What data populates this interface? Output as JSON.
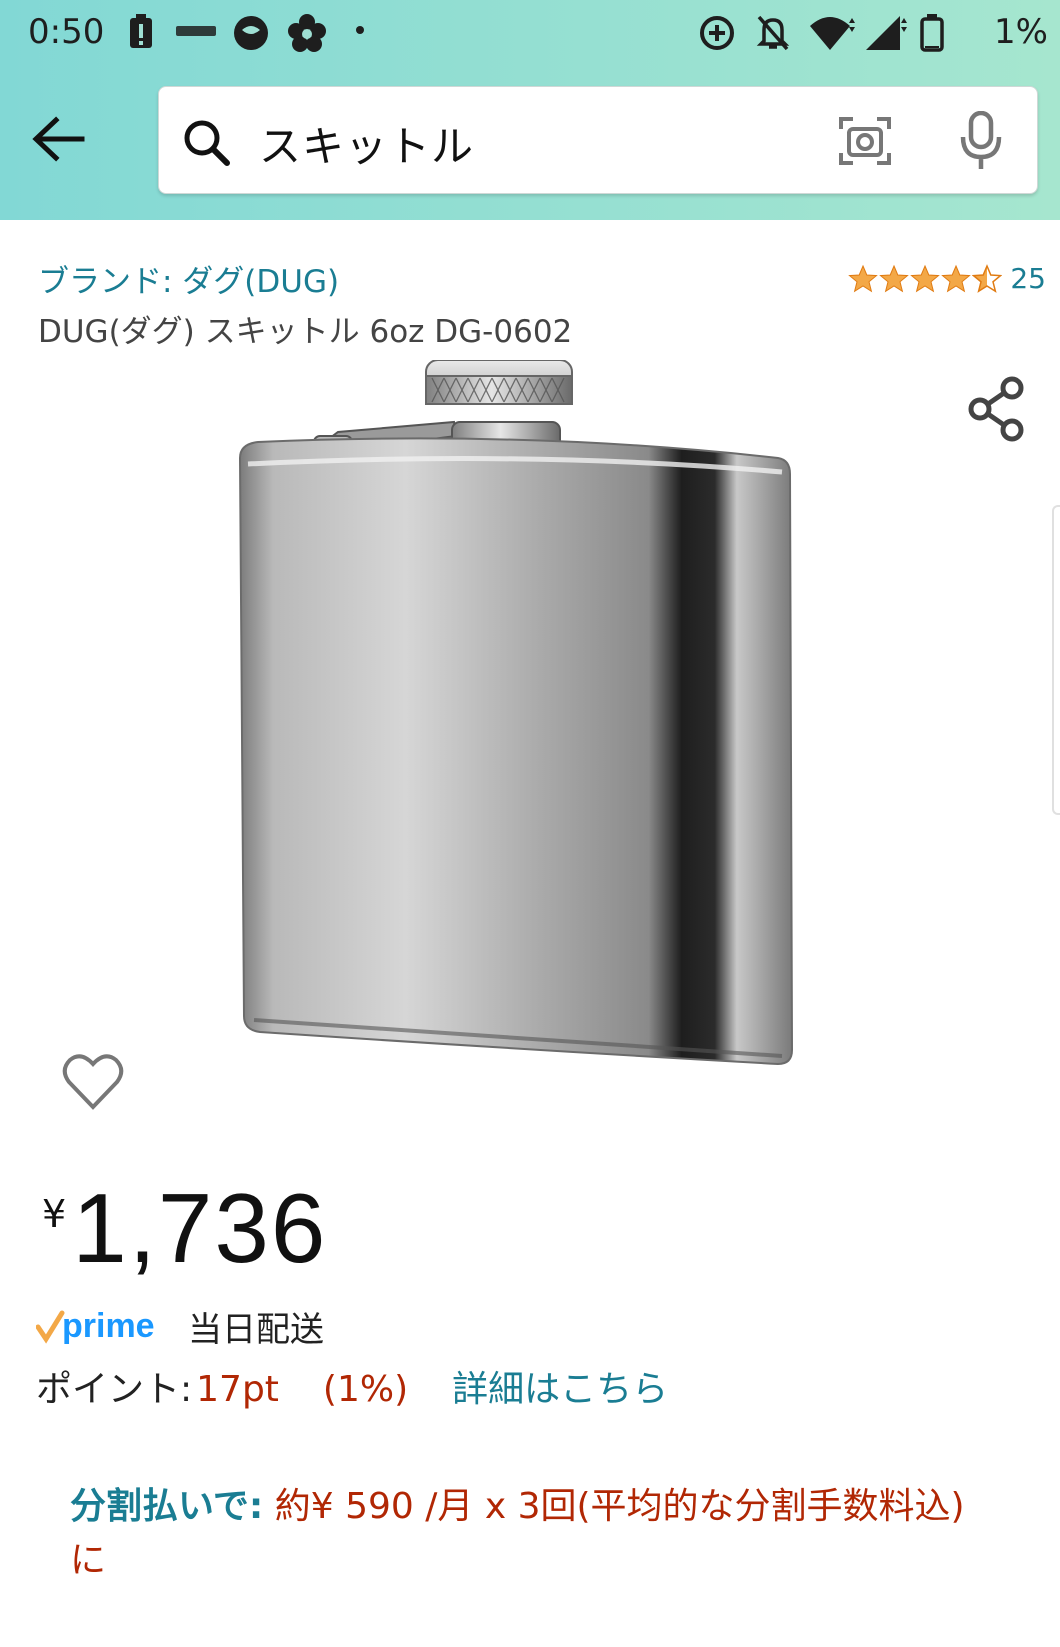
{
  "status_bar": {
    "time": "0:50",
    "battery_percent": "1%",
    "left_icons": [
      "alert-battery-icon",
      "app-notification-icon",
      "chat-bubble-icon",
      "flower-icon",
      "dot-icon"
    ],
    "right_icons": [
      "data-saver-icon",
      "silent-bell-icon",
      "wifi-icon",
      "signal-icon",
      "battery-icon"
    ]
  },
  "search": {
    "query": "スキットル"
  },
  "product": {
    "brand": "ブランド: ダグ(DUG)",
    "title": "DUG(ダグ) スキットル 6oz DG-0602",
    "rating": 4.5,
    "review_count": "25"
  },
  "price": {
    "currency": "¥",
    "amount": "1,736"
  },
  "prime": {
    "logo_text": "prime",
    "delivery": "当日配送"
  },
  "points": {
    "label": "ポイント:",
    "value": "17pt",
    "percent": "(1%)",
    "link": "詳細はこちら"
  },
  "installment": {
    "label": "分割払いで:",
    "text": " 約¥ 590 /月 x 3回(平均的な分割手数料込)に"
  },
  "colors": {
    "link": "#1a7d93",
    "price_red": "#b12704",
    "star": "#f3a847",
    "header_gradient_start": "#82d8d5",
    "header_gradient_end": "#a6e6cf"
  }
}
